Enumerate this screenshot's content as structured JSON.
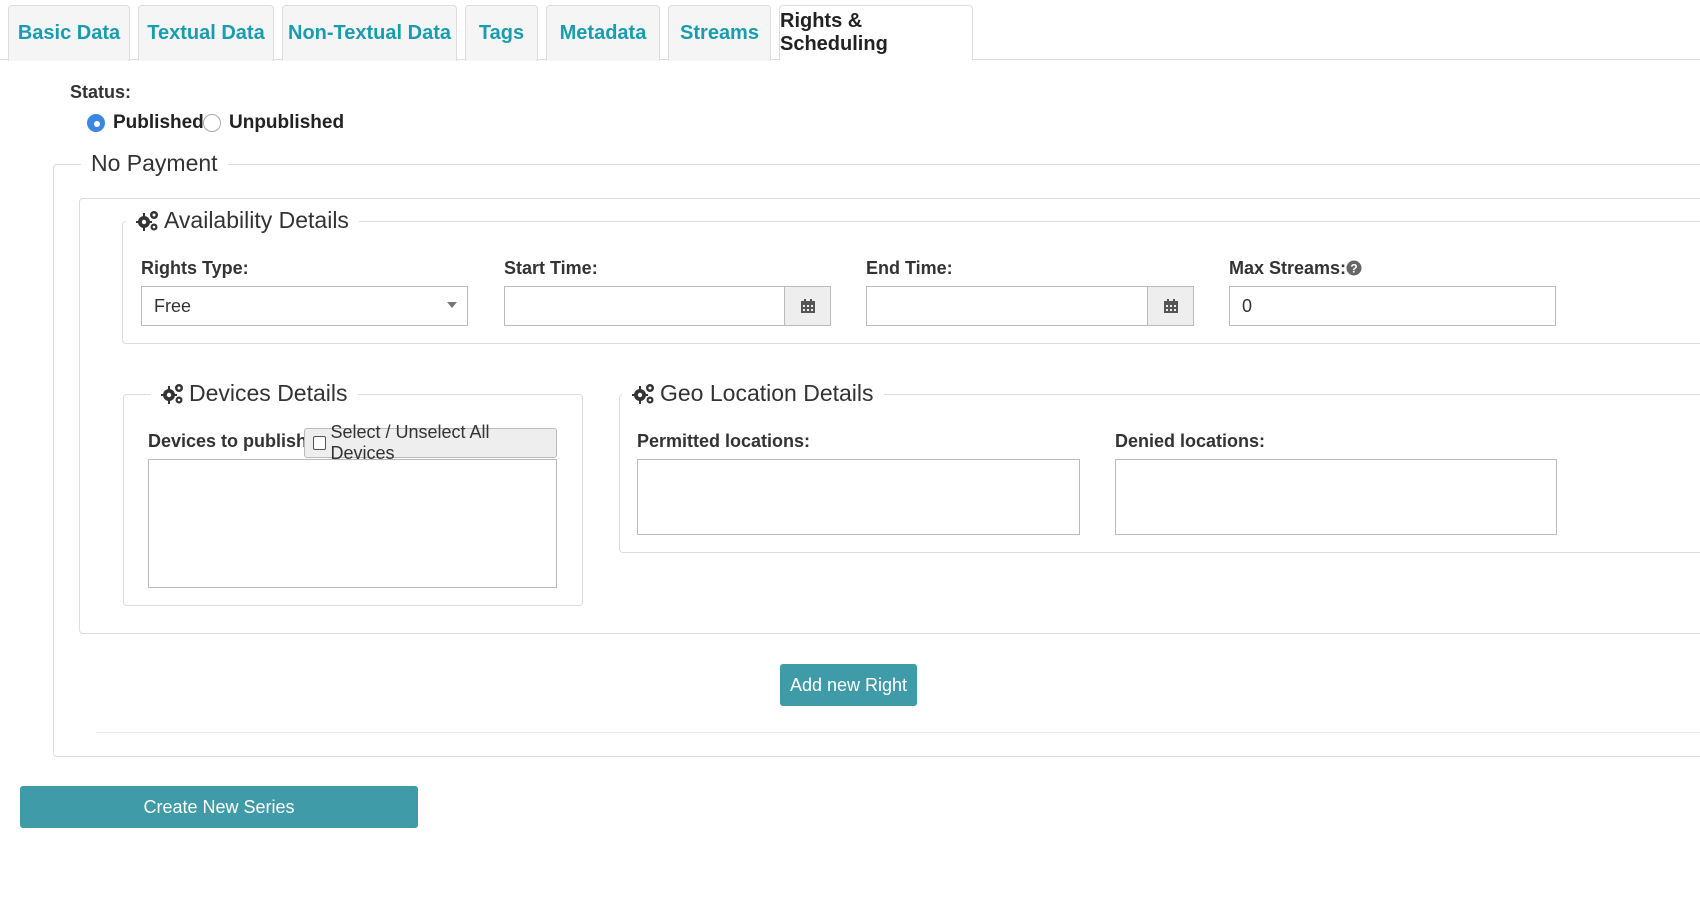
{
  "tabs": [
    {
      "label": "Basic Data"
    },
    {
      "label": "Textual Data"
    },
    {
      "label": "Non-Textual Data"
    },
    {
      "label": "Tags"
    },
    {
      "label": "Metadata"
    },
    {
      "label": "Streams"
    },
    {
      "label": "Rights & Scheduling",
      "active": true
    }
  ],
  "status": {
    "label": "Status:",
    "options": [
      "Published",
      "Unpublished"
    ],
    "selected": "Published"
  },
  "payment": {
    "legend": "No Payment"
  },
  "availability": {
    "legend": "Availability Details",
    "rights_type_label": "Rights Type:",
    "rights_type_value": "Free",
    "start_time_label": "Start Time:",
    "start_time_value": "",
    "end_time_label": "End Time:",
    "end_time_value": "",
    "max_streams_label": "Max Streams:",
    "max_streams_value": "0"
  },
  "devices": {
    "legend": "Devices Details",
    "label": "Devices to publish:",
    "select_all_label": "Select / Unselect All Devices"
  },
  "geo": {
    "legend": "Geo Location Details",
    "permitted_label": "Permitted locations:",
    "denied_label": "Denied locations:"
  },
  "buttons": {
    "add_right": "Add new Right",
    "create_series": "Create New Series"
  },
  "colors": {
    "tab_text": "#1a9cb0",
    "button_teal": "#3f9ba8",
    "radio_selected": "#3a86e0"
  }
}
